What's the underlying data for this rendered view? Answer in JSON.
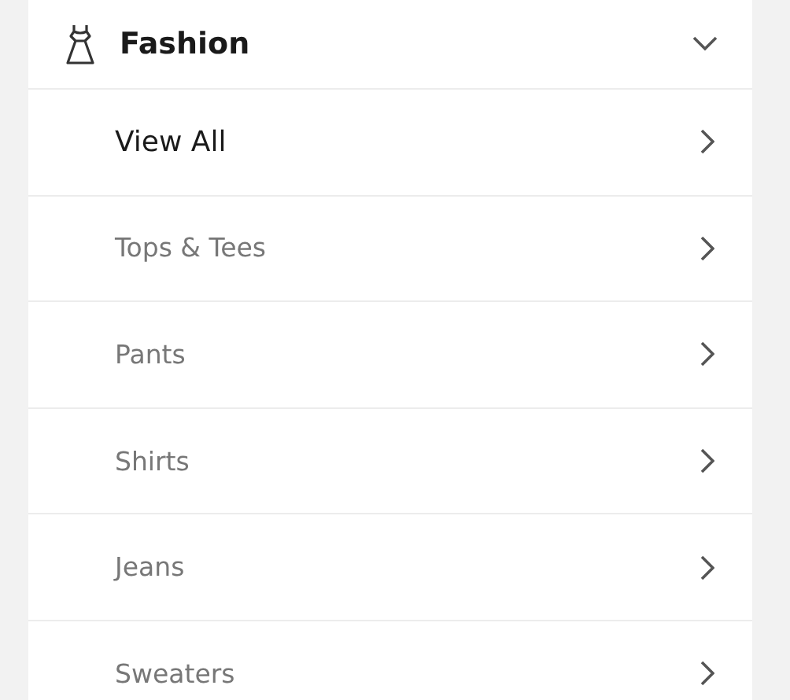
{
  "section": {
    "title": "Fashion",
    "expanded": true
  },
  "items": [
    {
      "label": "View All",
      "kind": "all"
    },
    {
      "label": "Tops & Tees",
      "kind": "category"
    },
    {
      "label": "Pants",
      "kind": "category"
    },
    {
      "label": "Shirts",
      "kind": "category"
    },
    {
      "label": "Jeans",
      "kind": "category"
    },
    {
      "label": "Sweaters",
      "kind": "category"
    }
  ]
}
